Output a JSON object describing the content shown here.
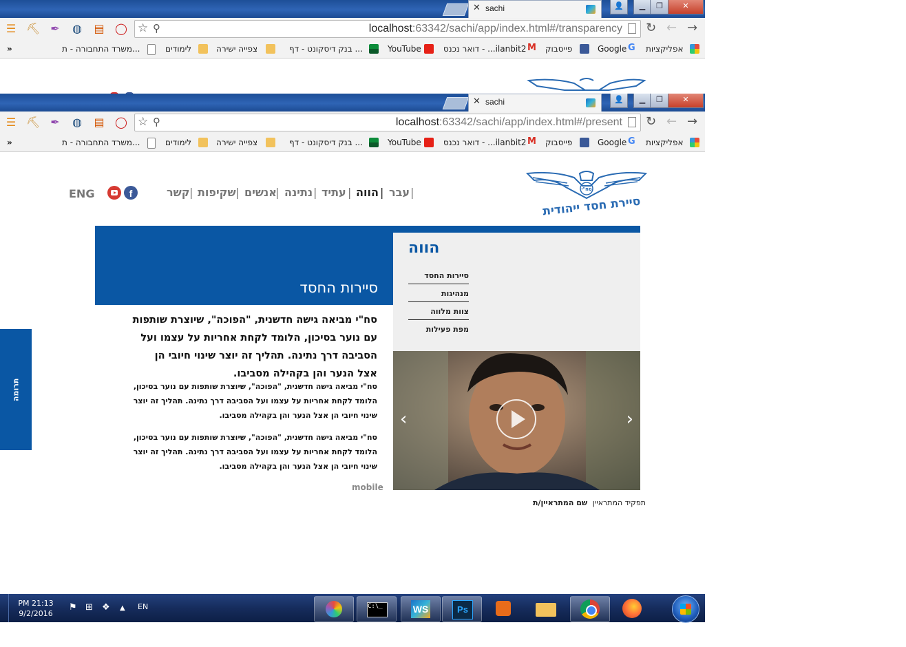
{
  "window_back": {
    "tab_title": "sachi",
    "url_host": "localhost",
    "url_path": ":63342/sachi/app/index.html#/transparency"
  },
  "window_front": {
    "tab_title": "sachi",
    "url_host": "localhost",
    "url_path": ":63342/sachi/app/index.html#/present"
  },
  "bookmarks": {
    "more": "»",
    "items": [
      {
        "label": "אפליקציות",
        "icon": "apps-grid-icon"
      },
      {
        "label": "Google",
        "icon": "google-icon"
      },
      {
        "label": "פייסבוק",
        "icon": "facebook-icon"
      },
      {
        "label": "דואר נכנס - ...ilanbit2",
        "icon": "gmail-icon"
      },
      {
        "label": "YouTube",
        "icon": "youtube-icon"
      },
      {
        "label": "בנק דיסקונט - דף ...",
        "icon": "discount-bank-icon"
      },
      {
        "label": "צפייה ישירה",
        "icon": "folder-icon"
      },
      {
        "label": "לימודים",
        "icon": "folder-icon"
      },
      {
        "label": "משרד התחבורה - ת...",
        "icon": "page-icon"
      }
    ]
  },
  "site": {
    "nav": [
      "עבר",
      "הווה",
      "עתיד",
      "נתינה",
      "אנשים",
      "שקיפות",
      "קשר"
    ],
    "nav_active": "הווה",
    "lang": "ENG",
    "logo_text": "סיירת חסד ייהודית",
    "logo_badge": "סח\"י",
    "hero_title": "סיירות החסד",
    "side_title": "הווה",
    "side_menu": [
      "סיירות החסד",
      "מנהיגות",
      "צוות מלווה",
      "מפת פעילות"
    ],
    "lead": "סח\"י מביאה גישה חדשנית, \"הפוכה\", שיוצרת שותפות עם נוער בסיכון, הלומד לקחת אחריות על עצמו ועל הסביבה דרך נתינה. תהליך זה יוצר שינוי חיובי הן אצל הנער והן בקהילה מסביבו.",
    "paragraphs": [
      "סח\"י מביאה גישה חדשנית, \"הפוכה\", שיוצרת שותפות עם נוער בסיכון, הלומד לקחת אחריות על עצמו ועל הסביבה דרך נתינה. תהליך זה יוצר שינוי חיובי הן אצל הנער והן בקהילה מסביבו.",
      "סח\"י מביאה גישה חדשנית, \"הפוכה\", שיוצרת שותפות עם נוער בסיכון, הלומד לקחת אחריות על עצמו ועל הסביבה דרך נתינה. תהליך זה יוצר שינוי חיובי הן אצל הנער והן בקהילה מסביבו."
    ],
    "mobile_label": "mobile",
    "caption_name": "שם המתראיין/ת",
    "caption_role": "תפקיד המתראיין",
    "donate": "תרומה",
    "brand_color": "#0a57a4"
  },
  "taskbar": {
    "time": "PM 21:13",
    "date": "9/2/2016",
    "lang": "EN",
    "apps": [
      "paint-icon",
      "cmd-icon",
      "webstorm-icon",
      "photoshop-icon",
      "media-player-icon",
      "file-explorer-icon",
      "chrome-icon",
      "firefox-icon"
    ]
  }
}
